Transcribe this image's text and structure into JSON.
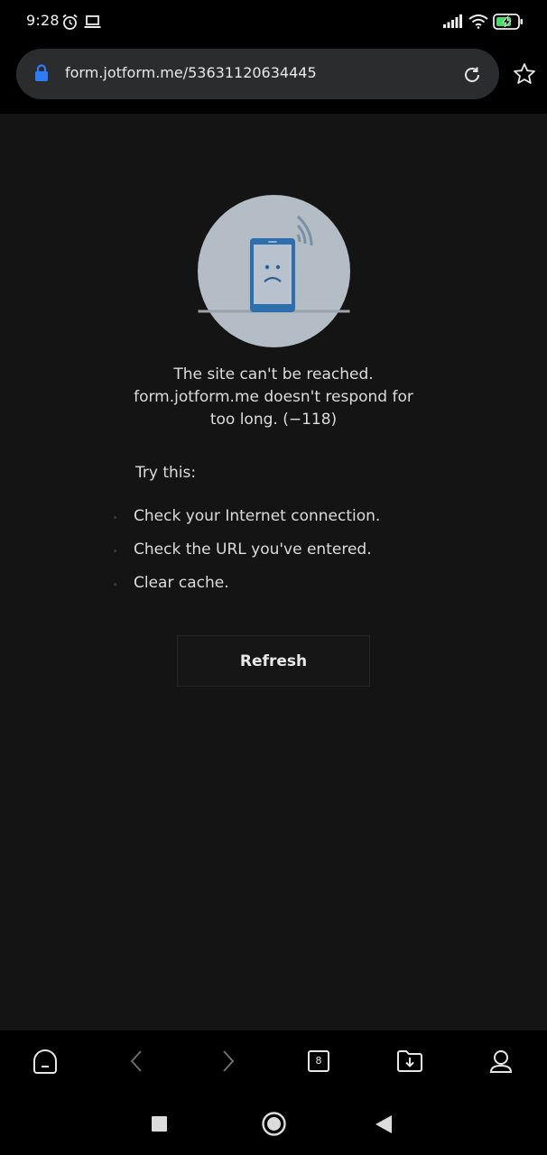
{
  "status_bar": {
    "time": "9:28",
    "icons": [
      "alarm-icon",
      "laptop-icon",
      "signal-icon",
      "wifi-icon",
      "battery-charging-icon"
    ]
  },
  "address_bar": {
    "url": "form.jotform.me/53631120634445",
    "lock_icon": "lock-icon",
    "reload_icon": "reload-icon",
    "bookmark_icon": "star-icon",
    "lock_color": "#2f7bf5"
  },
  "error": {
    "illustration": "phone-sad-face-icon",
    "line1": "The site can't be reached.",
    "line2": "form.jotform.me doesn't respond for",
    "line3": "too long. (−118)"
  },
  "suggestions": {
    "title": "Try this:",
    "items": [
      "Check your Internet connection.",
      "Check the URL you've entered.",
      "Clear cache."
    ]
  },
  "refresh_label": "Refresh",
  "toolbar": {
    "home_icon": "home-icon",
    "back_icon": "chevron-left-icon",
    "forward_icon": "chevron-right-icon",
    "tab_count": "8",
    "downloads_icon": "download-folder-icon",
    "profile_icon": "profile-icon"
  },
  "navbar": {
    "icons": [
      "recents-square-icon",
      "home-circle-icon",
      "back-triangle-icon"
    ]
  }
}
